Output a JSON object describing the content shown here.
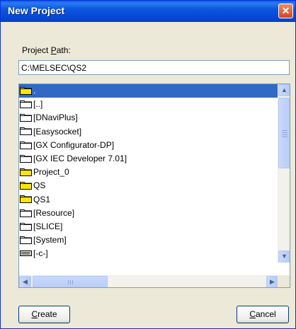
{
  "window": {
    "title": "New Project"
  },
  "path": {
    "label_pre": "Project ",
    "label_accel": "P",
    "label_post": "ath:",
    "value": "C:\\MELSEC\\QS2"
  },
  "list": {
    "items": [
      {
        "label": ".",
        "icon": "project-folder-icon",
        "selected": true
      },
      {
        "label": "[..]",
        "icon": "folder-icon"
      },
      {
        "label": "[DNaviPlus]",
        "icon": "folder-icon"
      },
      {
        "label": "[Easysocket]",
        "icon": "folder-icon"
      },
      {
        "label": "[GX Configurator-DP]",
        "icon": "folder-icon"
      },
      {
        "label": "[GX IEC Developer 7.01]",
        "icon": "folder-icon"
      },
      {
        "label": "Project_0",
        "icon": "project-folder-icon"
      },
      {
        "label": "QS",
        "icon": "project-folder-icon"
      },
      {
        "label": "QS1",
        "icon": "project-folder-icon"
      },
      {
        "label": "[Resource]",
        "icon": "folder-icon"
      },
      {
        "label": "[SLICE]",
        "icon": "folder-icon"
      },
      {
        "label": "[System]",
        "icon": "folder-icon"
      },
      {
        "label": "[-c-]",
        "icon": "drive-icon"
      }
    ]
  },
  "buttons": {
    "create": {
      "accel": "C",
      "rest": "reate"
    },
    "cancel": {
      "accel": "C",
      "rest": "ancel"
    }
  },
  "colors": {
    "titlebar": "#0446d2",
    "selection": "#316ac5",
    "project_folder": "#ffe600"
  }
}
